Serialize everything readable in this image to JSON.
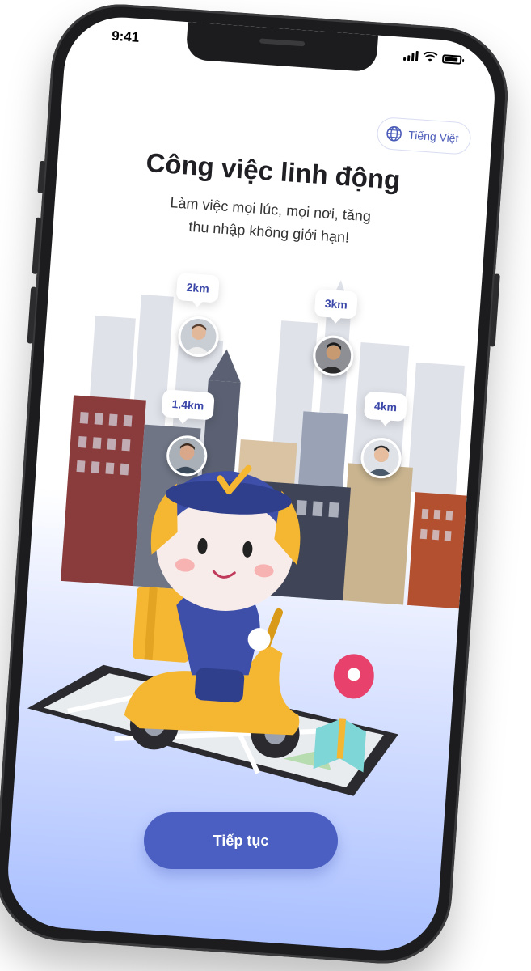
{
  "status_bar": {
    "time": "9:41"
  },
  "language_button": {
    "label": "Tiếng Việt",
    "icon": "globe-icon"
  },
  "onboarding": {
    "title": "Công việc linh động",
    "subtitle_line1": "Làm việc mọi lúc, mọi nơi, tăng",
    "subtitle_line2": "thu nhập không giới hạn!"
  },
  "drivers": [
    {
      "distance": "2km"
    },
    {
      "distance": "3km"
    },
    {
      "distance": "1.4km"
    },
    {
      "distance": "4km"
    }
  ],
  "cta": {
    "label": "Tiếp tục"
  },
  "colors": {
    "primary": "#4a5fc1",
    "accent_yellow": "#f5b731",
    "helmet_blue": "#3d4fa8",
    "pin_pink": "#e8416b"
  }
}
